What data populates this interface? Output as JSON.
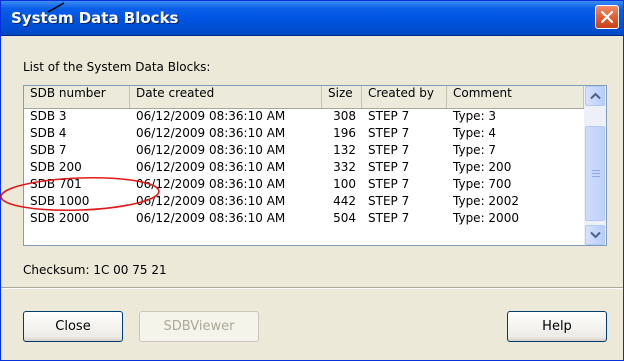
{
  "window": {
    "title": "System Data Blocks"
  },
  "list_label": "List of the System Data Blocks:",
  "table": {
    "columns": [
      "SDB number",
      "Date created",
      "Size",
      "Created by",
      "Comment"
    ],
    "rows": [
      [
        "SDB 3",
        "06/12/2009 08:36:10 AM",
        "308",
        "STEP 7",
        "Type: 3"
      ],
      [
        "SDB 4",
        "06/12/2009 08:36:10 AM",
        "196",
        "STEP 7",
        "Type: 4"
      ],
      [
        "SDB 7",
        "06/12/2009 08:36:10 AM",
        "132",
        "STEP 7",
        "Type: 7"
      ],
      [
        "SDB 200",
        "06/12/2009 08:36:10 AM",
        "332",
        "STEP 7",
        "Type: 200"
      ],
      [
        "SDB 701",
        "06/12/2009 08:36:10 AM",
        "100",
        "STEP 7",
        "Type: 700"
      ],
      [
        "SDB 1000",
        "06/12/2009 08:36:10 AM",
        "442",
        "STEP 7",
        "Type: 2002"
      ],
      [
        "SDB 2000",
        "06/12/2009 08:36:10 AM",
        "504",
        "STEP 7",
        "Type: 2000"
      ]
    ]
  },
  "checksum": "Checksum: 1C 00 75 21",
  "buttons": {
    "close": "Close",
    "sdbviewer": "SDBViewer",
    "help": "Help"
  },
  "icons": {
    "close": "close-x-icon",
    "scroll_up": "chevron-up-icon",
    "scroll_down": "chevron-down-icon"
  },
  "colors": {
    "title_bar": "#0054e3",
    "dialog_bg": "#ece9d8",
    "close_button": "#e05a2b",
    "annotation": "#e11919"
  }
}
